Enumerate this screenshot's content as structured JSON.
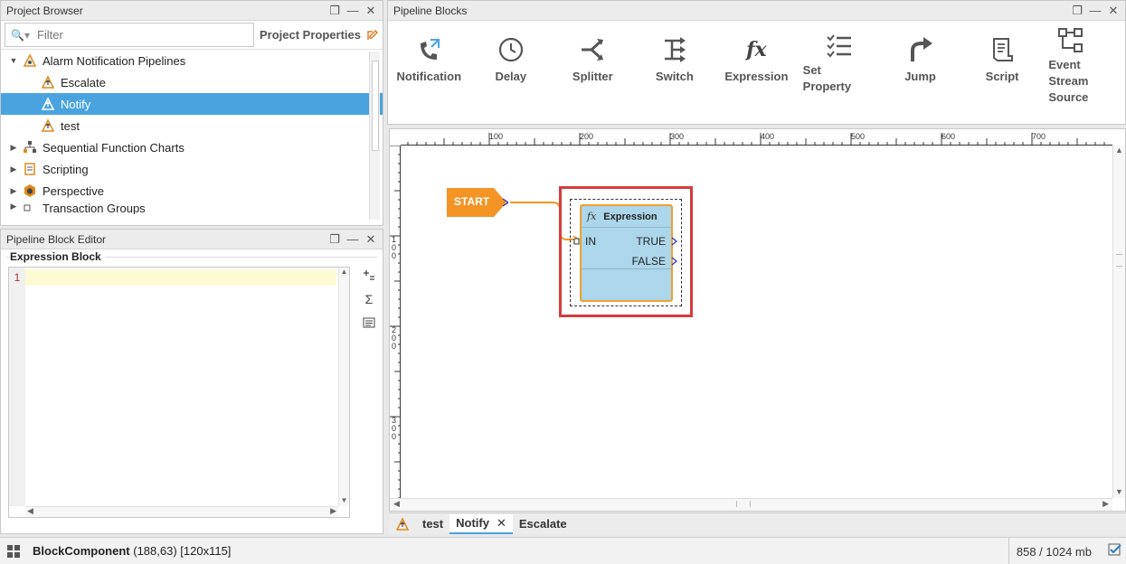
{
  "project_browser": {
    "title": "Project Browser",
    "filter_placeholder": "Filter",
    "project_properties_label": "Project Properties",
    "tree": [
      {
        "label": "Alarm Notification Pipelines",
        "level": 0,
        "expanded": true
      },
      {
        "label": "Escalate",
        "level": 1
      },
      {
        "label": "Notify",
        "level": 1,
        "selected": true
      },
      {
        "label": "test",
        "level": 1
      },
      {
        "label": "Sequential Function Charts",
        "level": 0
      },
      {
        "label": "Scripting",
        "level": 0
      },
      {
        "label": "Perspective",
        "level": 0
      },
      {
        "label": "Transaction Groups",
        "level": 0
      }
    ]
  },
  "block_editor": {
    "title": "Pipeline Block Editor",
    "group_label": "Expression Block",
    "line_number": "1"
  },
  "pipeline_blocks": {
    "title": "Pipeline Blocks",
    "items": [
      {
        "label": "Notification",
        "icon": "notification-icon"
      },
      {
        "label": "Delay",
        "icon": "clock-icon"
      },
      {
        "label": "Splitter",
        "icon": "splitter-icon"
      },
      {
        "label": "Switch",
        "icon": "switch-icon"
      },
      {
        "label": "Expression",
        "icon": "fx-icon"
      },
      {
        "label": "Set\nProperty",
        "icon": "checklist-icon"
      },
      {
        "label": "Jump",
        "icon": "jump-arrow-icon"
      },
      {
        "label": "Script",
        "icon": "script-icon"
      },
      {
        "label": "Event\nStream\nSource",
        "icon": "event-stream-icon"
      }
    ]
  },
  "canvas": {
    "ruler_top_labels": [
      "100",
      "200",
      "300",
      "400",
      "500",
      "600",
      "700"
    ],
    "ruler_left_labels": [
      "100",
      "200",
      "300"
    ],
    "start_label": "START",
    "expression_block": {
      "title": "Expression",
      "fx": "fx",
      "in_port": "IN",
      "true_port": "TRUE",
      "false_port": "FALSE"
    }
  },
  "tabs": [
    {
      "label": "test"
    },
    {
      "label": "Notify",
      "active": true,
      "closable": true
    },
    {
      "label": "Escalate"
    }
  ],
  "status_bar": {
    "component_name": "BlockComponent",
    "component_info": "(188,63) [120x115]",
    "memory": "858 / 1024 mb"
  },
  "colors": {
    "selection": "#4aa3df",
    "start_block": "#f39425",
    "expression_fill": "#acd6ea",
    "selection_outline": "#d63b3b"
  }
}
